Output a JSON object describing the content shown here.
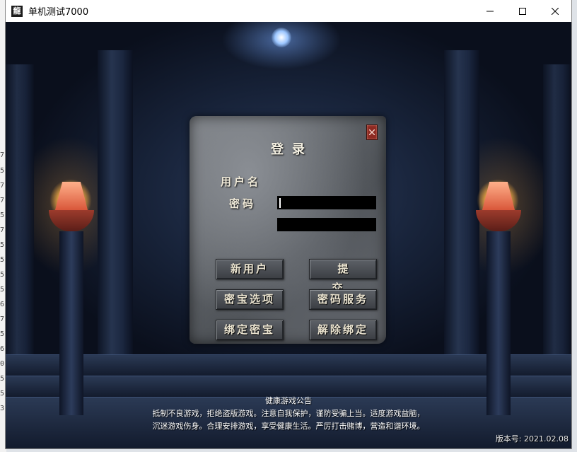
{
  "window": {
    "icon_text": "龍",
    "title": "单机测试7000"
  },
  "desktop": {
    "edge_digits": [
      "7",
      "5",
      "7",
      "7",
      "5",
      "7",
      "5",
      "5",
      "5",
      "5",
      "6",
      "7",
      "5",
      "6",
      "0",
      "5",
      "5",
      "3"
    ]
  },
  "login": {
    "title": "登录",
    "username_label": "用户名",
    "password_label": "密码",
    "username_value": "",
    "password_value": "",
    "buttons": {
      "new_user": "新用户",
      "submit": "提 交",
      "secret_options": "密宝选项",
      "password_service": "密码服务",
      "bind_secret": "绑定密宝",
      "unbind": "解除绑定"
    }
  },
  "notice": {
    "heading": "健康游戏公告",
    "line1": "抵制不良游戏，拒绝盗版游戏。注意自我保护，谨防受骗上当。适度游戏益脑，",
    "line2": "沉迷游戏伤身。合理安排游戏，享受健康生活。严厉打击赌博，营造和谐环境。"
  },
  "version": "版本号: 2021.02.08",
  "colors": {
    "titlebar": "#ffffff",
    "panel_stone": "#6b6f74",
    "button_text": "#eae3cf",
    "close_red": "#8d2a22"
  }
}
